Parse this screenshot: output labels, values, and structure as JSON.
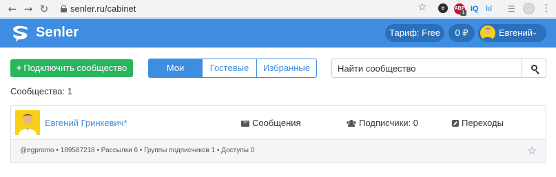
{
  "browser": {
    "url": "senler.ru/cabinet",
    "back_icon": "back-arrow-icon",
    "forward_icon": "forward-arrow-icon",
    "reload_icon": "reload-icon",
    "extensions": {
      "abp_badge": "1",
      "iq_label": "IQ",
      "graph_label": "lıl"
    }
  },
  "header": {
    "logo_text": "Senler",
    "tariff_label": "Тариф: Free",
    "balance_label": "0 ₽",
    "user_name": "Евгений",
    "user_caret": "⌄"
  },
  "toolbar": {
    "add_button_plus": "+",
    "add_button_label": "Подключить сообщество",
    "tabs": [
      {
        "label": "Мои",
        "active": true
      },
      {
        "label": "Гостевые",
        "active": false
      },
      {
        "label": "Избранные",
        "active": false
      }
    ],
    "search_placeholder": "Найти сообщество"
  },
  "communities_count_label": "Сообщества: 1",
  "community": {
    "name": "Евгений Гринкевич*",
    "messages_label": "Сообщения",
    "subscribers_label": "Подписчики: 0",
    "transitions_label": "Переходы",
    "meta": "@egpromo • 189587218 • Рассылки 6 • Группы подписчиков 1 • Доступы 0"
  },
  "colors": {
    "brand_blue": "#3e8de0",
    "header_pill": "#2c6fba",
    "add_green": "#2bb55e",
    "avatar_yellow": "#f7d117"
  }
}
